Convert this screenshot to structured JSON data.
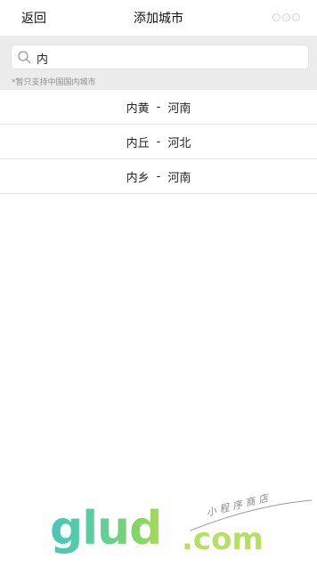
{
  "navbar": {
    "back_label": "返回",
    "title": "添加城市"
  },
  "search": {
    "value": "内",
    "hint": "*暂只支持中国国内城市"
  },
  "cities": [
    {
      "name": "内黄",
      "sep": "-",
      "province": "河南"
    },
    {
      "name": "内丘",
      "sep": "-",
      "province": "河北"
    },
    {
      "name": "内乡",
      "sep": "-",
      "province": "河南"
    }
  ],
  "watermark": {
    "logo": "glud",
    "domain": ".com",
    "tagline": "小程序商店"
  },
  "colors": {
    "search_bg": "#ececec",
    "divider": "#e4e4e4",
    "hint_text": "#8d8d8d",
    "watermark_green": "#7fd46c",
    "watermark_teal": "#49c6b9"
  }
}
